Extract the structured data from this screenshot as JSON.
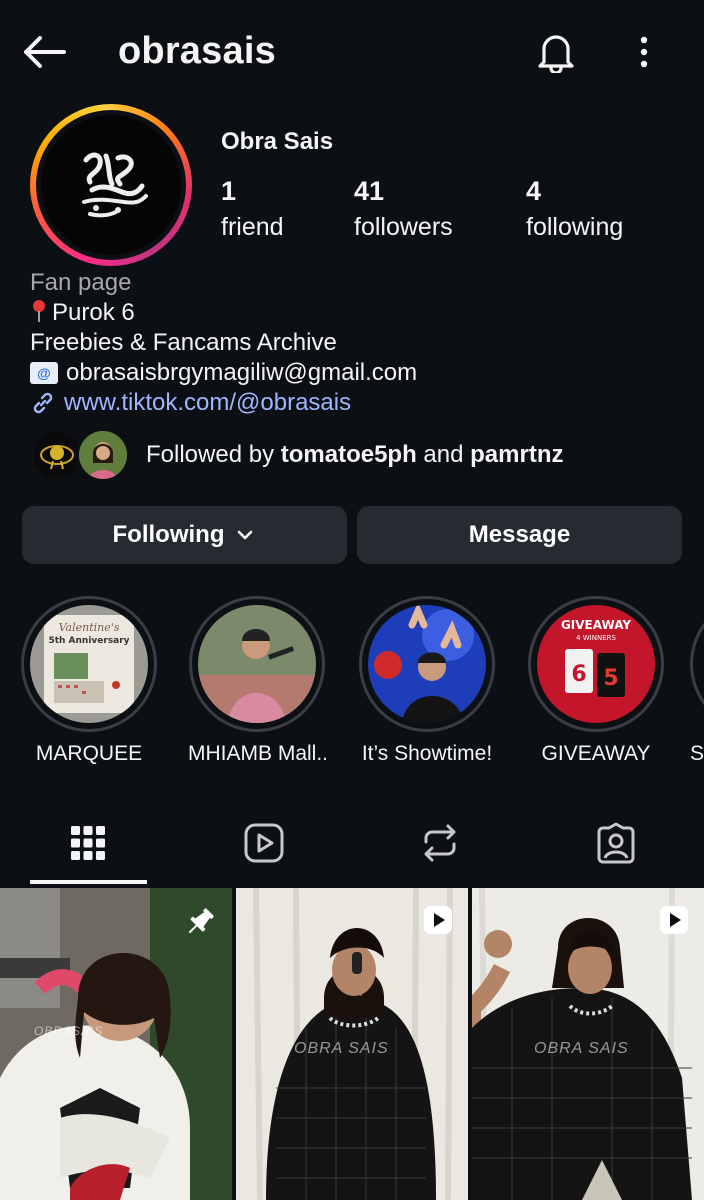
{
  "header": {
    "username": "obrasais"
  },
  "profile": {
    "display_name": "Obra Sais",
    "stats": [
      {
        "value": "1",
        "label": "friend"
      },
      {
        "value": "41",
        "label": "followers"
      },
      {
        "value": "4",
        "label": "following"
      }
    ],
    "category": "Fan page",
    "location": "Purok 6",
    "description": "Freebies & Fancams Archive",
    "email": "obrasaisbrgymagiliw@gmail.com",
    "link": "www.tiktok.com/@obrasais",
    "followed_by": {
      "prefix": "Followed by ",
      "user1": "tomatoe5ph",
      "joiner": " and ",
      "user2": "pamrtnz"
    }
  },
  "actions": {
    "following_label": "Following",
    "message_label": "Message"
  },
  "highlights": [
    {
      "label": "MARQUEE"
    },
    {
      "label": "MHIAMB Mall..."
    },
    {
      "label": "It’s Showtime!"
    },
    {
      "label": "GIVEAWAY"
    },
    {
      "label": "SI"
    }
  ],
  "highlight_text": {
    "marquee_title": "Valentine's",
    "marquee_sub": "5th Anniversary",
    "giveaway_title": "GIVEAWAY",
    "giveaway_sub": "4 WINNERS",
    "giveaway_num1": "6",
    "giveaway_num2": "5"
  },
  "tabs": [
    {
      "name": "posts",
      "icon": "grid-icon",
      "active": true
    },
    {
      "name": "reels",
      "icon": "reels-play-icon",
      "active": false
    },
    {
      "name": "reposts",
      "icon": "repost-icon",
      "active": false
    },
    {
      "name": "tagged",
      "icon": "tagged-person-icon",
      "active": false
    }
  ],
  "posts": [
    {
      "watermark": "OBRASAIS",
      "badge": "pin-icon"
    },
    {
      "watermark": "OBRA SAIS",
      "badge": "reel-icon"
    },
    {
      "watermark": "OBRA SAIS",
      "badge": "reel-icon"
    }
  ],
  "colors": {
    "background": "#0c0f14",
    "button": "#262a31",
    "link": "#9fb6ff",
    "muted": "#a8a8a8"
  }
}
